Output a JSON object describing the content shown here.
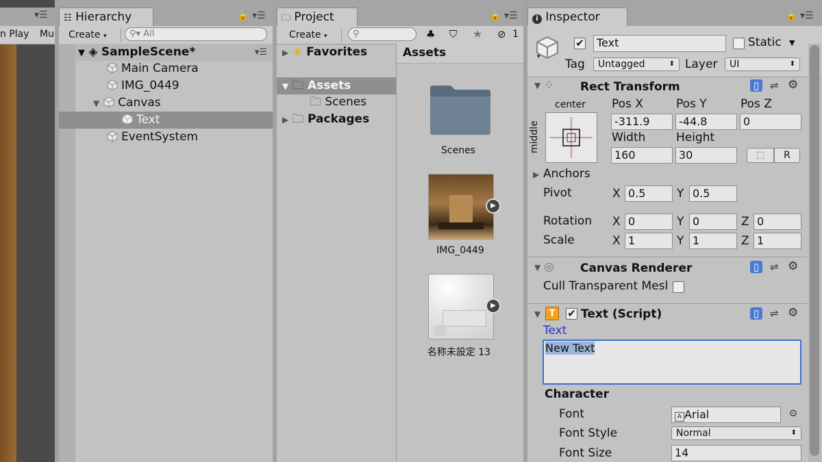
{
  "scene_view": {
    "tab_play": "n Play",
    "tab_mu": "Mu"
  },
  "hierarchy": {
    "tab_label": "Hierarchy",
    "create_label": "Create",
    "search_placeholder": "All",
    "scene_name": "SampleScene*",
    "items": [
      {
        "label": "Main Camera"
      },
      {
        "label": "IMG_0449"
      },
      {
        "label": "Canvas"
      },
      {
        "label": "Text"
      },
      {
        "label": "EventSystem"
      }
    ]
  },
  "project": {
    "tab_label": "Project",
    "create_label": "Create",
    "hidden_count": "1",
    "tree": {
      "favorites": "Favorites",
      "assets": "Assets",
      "scenes": "Scenes",
      "packages": "Packages"
    },
    "assets_header": "Assets",
    "assets": [
      {
        "name": "Scenes",
        "kind": "folder"
      },
      {
        "name": "IMG_0449",
        "kind": "image"
      },
      {
        "name": "名称未設定 13",
        "kind": "image"
      }
    ]
  },
  "inspector": {
    "tab_label": "Inspector",
    "object_name": "Text",
    "static_label": "Static",
    "tag_label": "Tag",
    "tag_value": "Untagged",
    "layer_label": "Layer",
    "layer_value": "UI",
    "rect_transform": {
      "title": "Rect Transform",
      "anchor_h": "center",
      "anchor_v": "middle",
      "pos_x_label": "Pos X",
      "pos_x": "-311.9",
      "pos_y_label": "Pos Y",
      "pos_y": "-44.8",
      "pos_z_label": "Pos Z",
      "pos_z": "0",
      "width_label": "Width",
      "width": "160",
      "height_label": "Height",
      "height": "30",
      "r_button": "R",
      "anchors_label": "Anchors",
      "pivot_label": "Pivot",
      "pivot_x": "0.5",
      "pivot_y": "0.5",
      "rotation_label": "Rotation",
      "rot_x": "0",
      "rot_y": "0",
      "rot_z": "0",
      "scale_label": "Scale",
      "scale_x": "1",
      "scale_y": "1",
      "scale_z": "1",
      "x": "X",
      "y": "Y",
      "z": "Z"
    },
    "canvas_renderer": {
      "title": "Canvas Renderer",
      "cull_label": "Cull Transparent Mesl"
    },
    "text_script": {
      "title": "Text (Script)",
      "text_label": "Text",
      "text_value": "New Text",
      "character_label": "Character",
      "font_label": "Font",
      "font_value": "Arial",
      "font_style_label": "Font Style",
      "font_style_value": "Normal",
      "font_size_label": "Font Size",
      "font_size_value": "14"
    }
  },
  "colors": {
    "panel_bg": "#c2c2c2",
    "selection": "#8f8f8f",
    "text_blue": "#2233cc",
    "accent_highlight": "#3a6fd0"
  }
}
